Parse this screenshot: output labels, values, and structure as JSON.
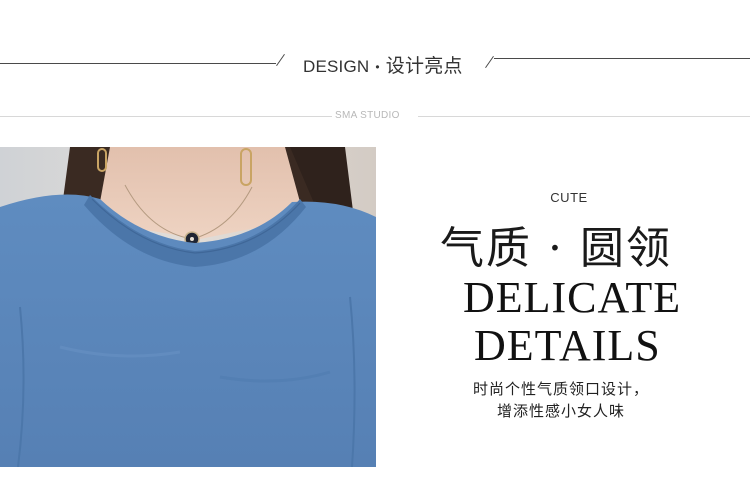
{
  "header": {
    "title_en": "DESIGN",
    "separator": "•",
    "title_cn": "设计亮点"
  },
  "studio": {
    "label": "SMA STUDIO"
  },
  "photo": {
    "subject": "woman in blue crewneck sweatshirt with pendant necklace",
    "colors": {
      "sweater": "#5a86b9",
      "collar": "#4a74a6",
      "skin": "#e9cbb8",
      "hair": "#3a2a22",
      "background": "#d9d5d1"
    }
  },
  "feature": {
    "small_label": "CUTE",
    "cn_headline": "气质 · 圆领",
    "en_line1": "DELICATE",
    "en_line2": "DETAILS",
    "desc_line1": "时尚个性气质领口设计，",
    "desc_line2": "增添性感小女人味"
  }
}
